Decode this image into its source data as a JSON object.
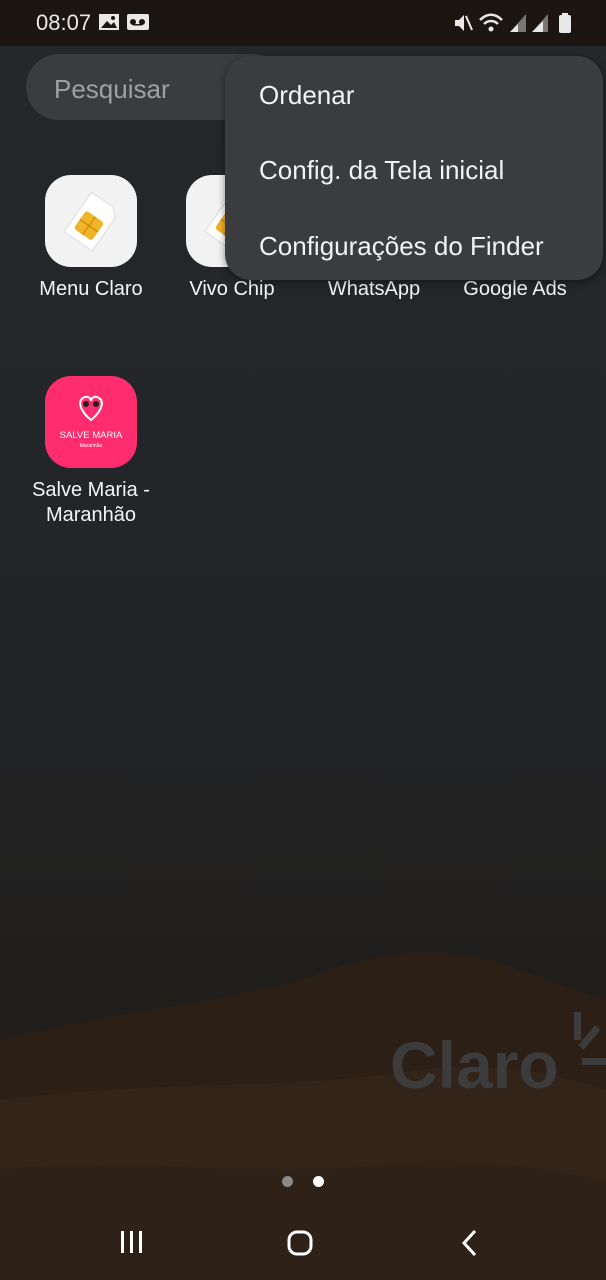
{
  "status_bar": {
    "time": "08:07",
    "left_icons": [
      "gallery-icon",
      "voicemail-icon"
    ],
    "right_icons": [
      "mute-icon",
      "wifi-icon",
      "signal-icon",
      "signal-icon",
      "battery-icon"
    ]
  },
  "search": {
    "placeholder": "Pesquisar"
  },
  "menu": {
    "items": [
      "Ordenar",
      "Config. da Tela inicial",
      "Configurações do Finder"
    ]
  },
  "apps": [
    {
      "label": "Menu Claro",
      "icon": "sim-card-icon"
    },
    {
      "label": "Vivo Chip",
      "icon": "sim-card-icon"
    },
    {
      "label": "WhatsApp",
      "icon": "whatsapp-icon"
    },
    {
      "label": "Google Ads",
      "icon": "google-ads-icon"
    },
    {
      "label": "Salve Maria - Maranhão",
      "icon": "salve-maria-icon",
      "icon_text": "SALVE MARIA",
      "icon_subtext": "Maranhão"
    }
  ],
  "wallpaper": {
    "brand": "Claro"
  },
  "pagination": {
    "pages": 2,
    "current": 2
  },
  "nav": {
    "icons": [
      "recent-apps-icon",
      "home-icon",
      "back-icon"
    ]
  },
  "colors": {
    "accent_pink": "#ff2d6f",
    "menu_bg": "#3b3c3e",
    "background": "#222426"
  }
}
